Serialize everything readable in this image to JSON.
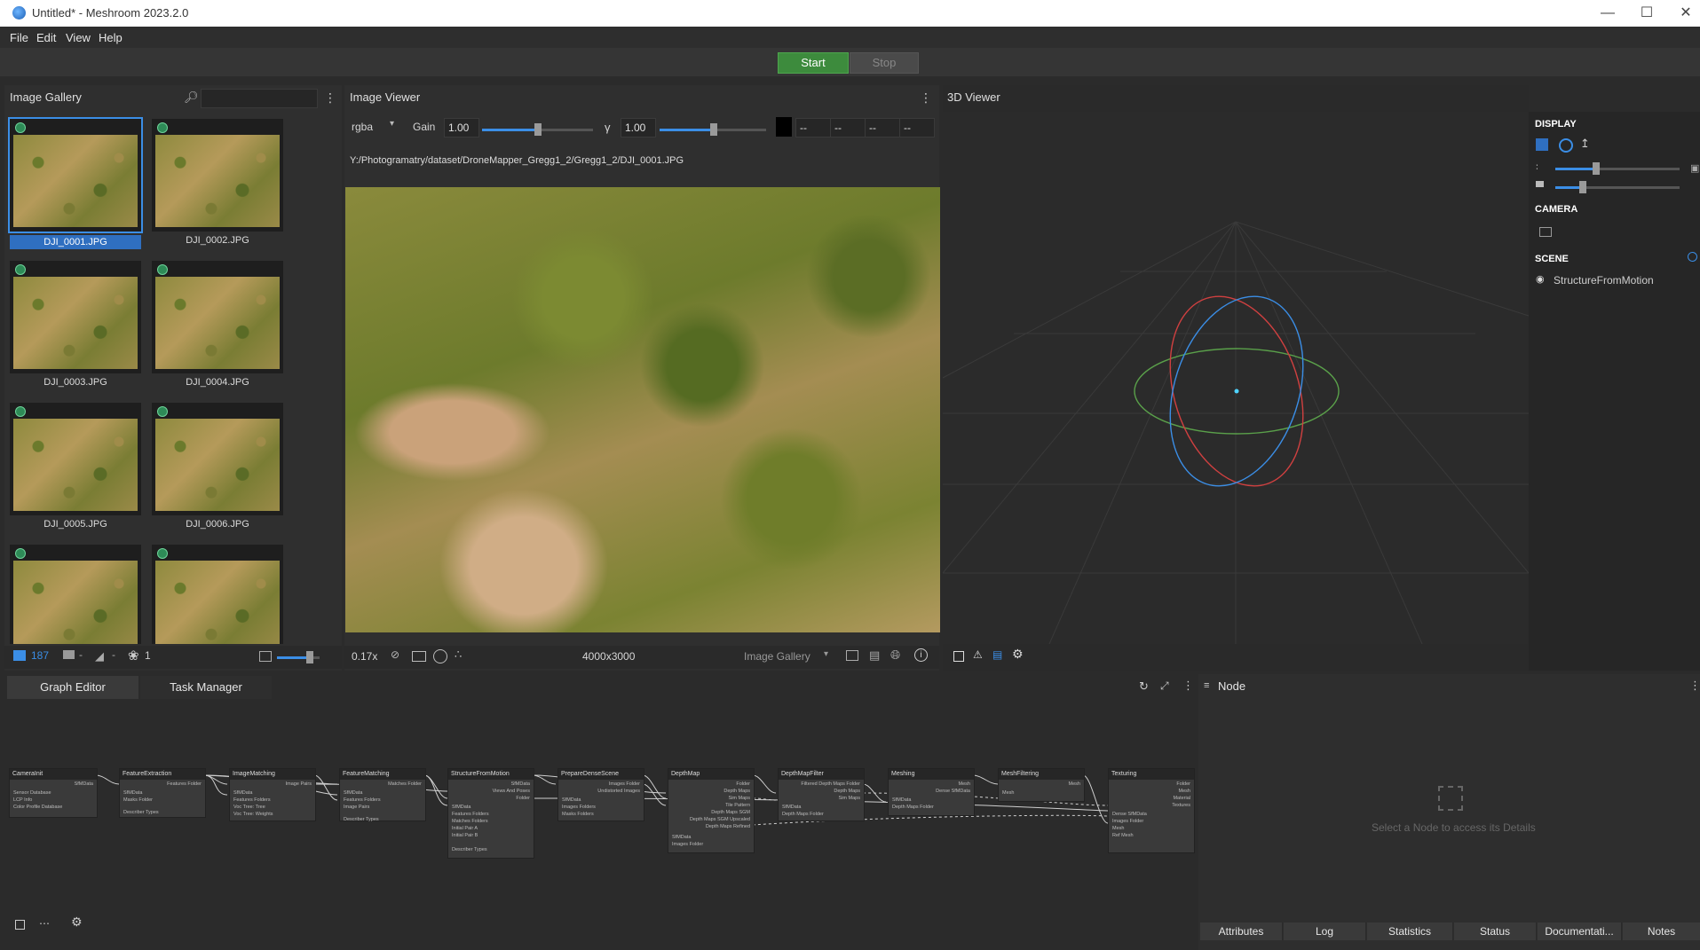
{
  "window": {
    "title": "Untitled* - Meshroom 2023.2.0",
    "minimize": "—",
    "maximize": "☐",
    "close": "✕"
  },
  "menu": {
    "file": "File",
    "edit": "Edit",
    "view": "View",
    "help": "Help"
  },
  "toolbar": {
    "start": "Start",
    "stop": "Stop"
  },
  "gallery": {
    "title": "Image Gallery",
    "search_placeholder": "",
    "images": [
      "DJI_0001.JPG",
      "DJI_0002.JPG",
      "DJI_0003.JPG",
      "DJI_0004.JPG",
      "DJI_0005.JPG",
      "DJI_0006.JPG",
      "",
      ""
    ],
    "selected_index": 0,
    "footer": {
      "image_count": "187",
      "cam_count": "-",
      "intr_count": "-",
      "group_count": "1"
    }
  },
  "image_viewer": {
    "title": "Image Viewer",
    "channel": "rgba",
    "gain_label": "Gain",
    "gain": "1.00",
    "gamma_label": "γ",
    "gamma": "1.00",
    "color_fields": [
      "--",
      "--",
      "--",
      "--"
    ],
    "path": "Y:/Photogramatry/dataset/DroneMapper_Gregg1_2/Gregg1_2/DJI_0001.JPG",
    "zoom": "0.17x",
    "resolution": "4000x3000",
    "source": "Image Gallery"
  },
  "viewer3d": {
    "title": "3D Viewer",
    "display_header": "DISPLAY",
    "camera_header": "CAMERA",
    "scene_header": "SCENE",
    "scene_items": [
      "StructureFromMotion"
    ]
  },
  "graph": {
    "tabs": [
      "Graph Editor",
      "Task Manager"
    ],
    "nodes": [
      {
        "name": "CameraInit",
        "inputs": [
          "Sensor Database",
          "LCP Info",
          "Color Profile Database"
        ],
        "outputs": [
          "SfMData"
        ]
      },
      {
        "name": "FeatureExtraction",
        "inputs": [
          "SfMData",
          "Masks Folder",
          "Describer Types"
        ],
        "outputs": [
          "Features Folder"
        ]
      },
      {
        "name": "ImageMatching",
        "inputs": [
          "SfMData",
          "Features Folders",
          "Voc Tree: Tree",
          "Voc Tree: Weights"
        ],
        "outputs": [
          "Image Pairs"
        ]
      },
      {
        "name": "FeatureMatching",
        "inputs": [
          "SfMData",
          "Features Folders",
          "Image Pairs",
          "Describer Types"
        ],
        "outputs": [
          "Matches Folder"
        ]
      },
      {
        "name": "StructureFromMotion",
        "inputs": [
          "SfMData",
          "Features Folders",
          "Matches Folders",
          "Initial Pair A",
          "Initial Pair B",
          "Describer Types"
        ],
        "outputs": [
          "SfMData",
          "Views And Poses",
          "Folder"
        ]
      },
      {
        "name": "PrepareDenseScene",
        "inputs": [
          "SfMData",
          "Images Folders",
          "Masks Folders"
        ],
        "outputs": [
          "Images Folder",
          "Undistorted Images"
        ]
      },
      {
        "name": "DepthMap",
        "inputs": [
          "SfMData",
          "Images Folder"
        ],
        "outputs": [
          "Folder",
          "Depth Maps",
          "Sim Maps",
          "Tile Pattern",
          "Depth Maps SGM",
          "Depth Maps SGM Upscaled",
          "Depth Maps Refined"
        ]
      },
      {
        "name": "DepthMapFilter",
        "inputs": [
          "SfMData",
          "Depth Maps Folder"
        ],
        "outputs": [
          "Filtered Depth Maps Folder",
          "Depth Maps",
          "Sim Maps"
        ]
      },
      {
        "name": "Meshing",
        "inputs": [
          "SfMData",
          "Depth Maps Folder"
        ],
        "outputs": [
          "Mesh",
          "Dense SfMData"
        ]
      },
      {
        "name": "MeshFiltering",
        "inputs": [
          "Mesh"
        ],
        "outputs": [
          "Mesh"
        ]
      },
      {
        "name": "Texturing",
        "inputs": [
          "Dense SfMData",
          "Images Folder",
          "Mesh",
          "Ref Mesh"
        ],
        "outputs": [
          "Folder",
          "Mesh",
          "Material",
          "Textures"
        ]
      }
    ]
  },
  "node_panel": {
    "title": "Node",
    "empty_message": "Select a Node to access its Details",
    "tabs": [
      "Attributes",
      "Log",
      "Statistics",
      "Status",
      "Documentati...",
      "Notes"
    ]
  },
  "colors": {
    "accent": "#3b8ee6",
    "start": "#3d8b3d",
    "panel": "#2f2f2f"
  }
}
